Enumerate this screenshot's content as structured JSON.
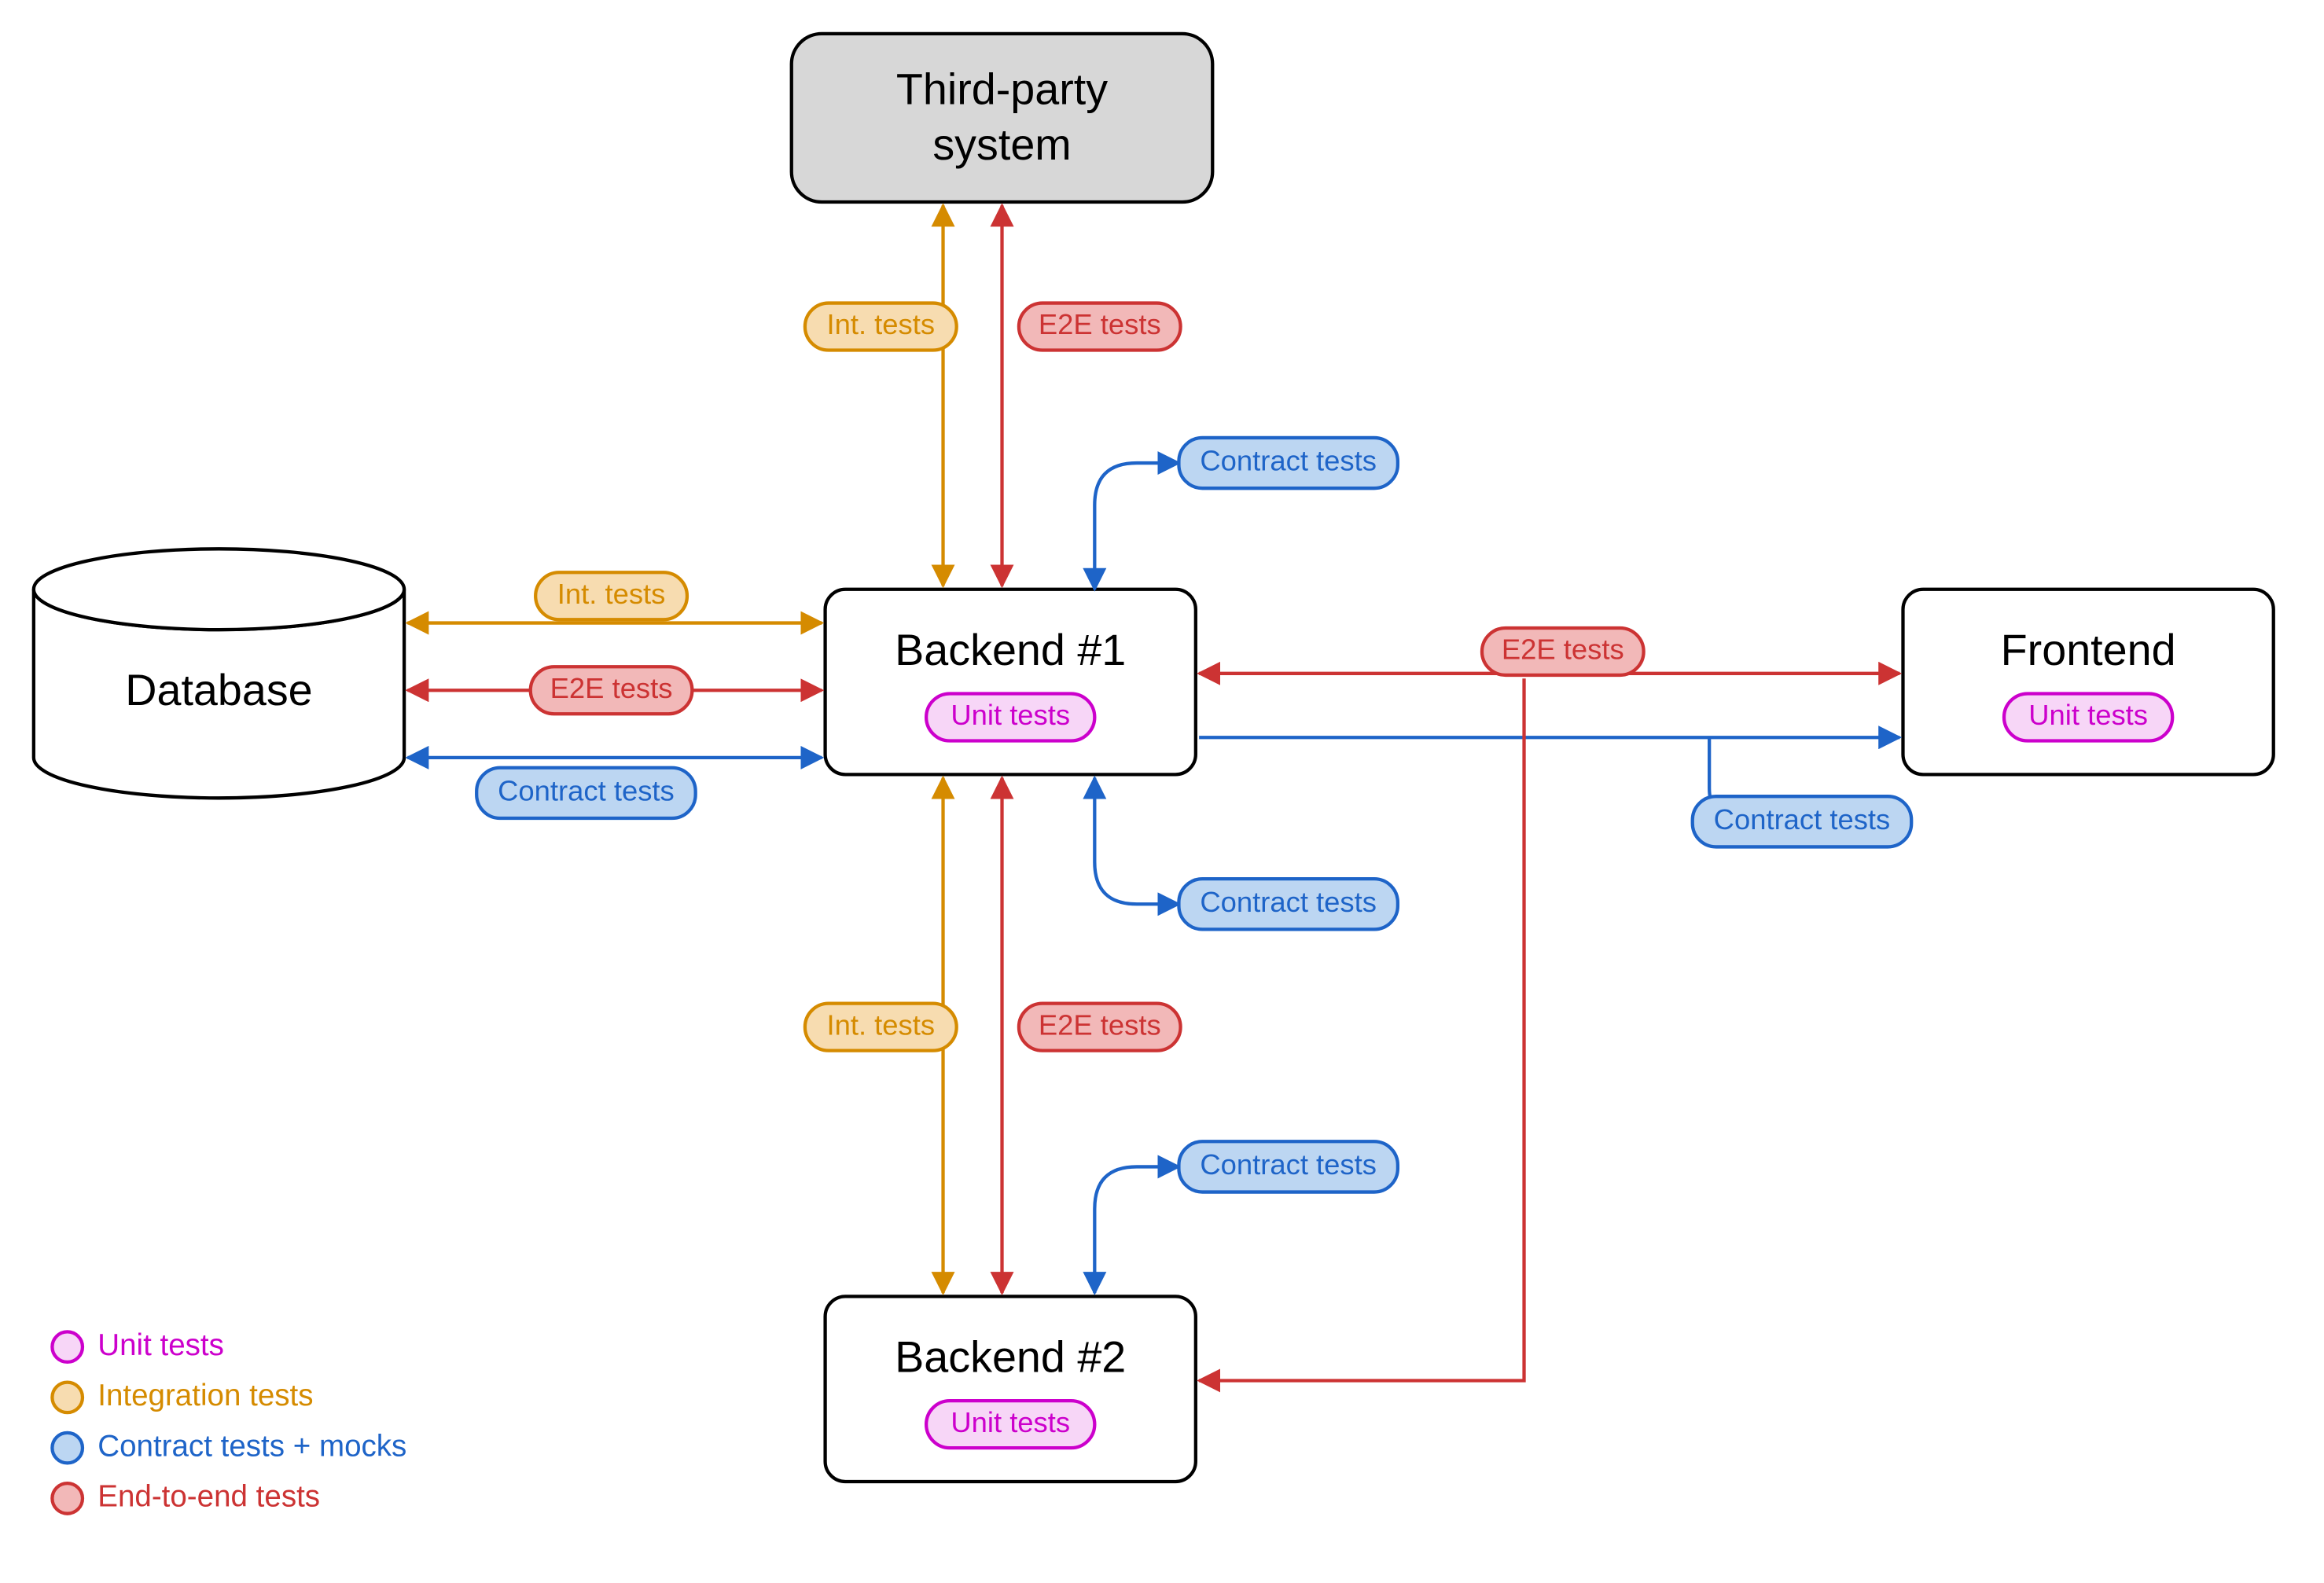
{
  "colors": {
    "unit": {
      "stroke": "#cc00cc",
      "fill": "#f7d6f7",
      "text": "#cc00cc"
    },
    "int": {
      "stroke": "#d58b00",
      "fill": "#f7dcb0",
      "text": "#d58b00"
    },
    "contract": {
      "stroke": "#1e64c8",
      "fill": "#bcd6f2",
      "text": "#1e64c8"
    },
    "e2e": {
      "stroke": "#cc3333",
      "fill": "#f2b8b8",
      "text": "#cc3333"
    },
    "black": "#000000"
  },
  "nodes": {
    "thirdparty": {
      "title1": "Third-party",
      "title2": "system"
    },
    "database": {
      "title": "Database"
    },
    "backend1": {
      "title": "Backend #1",
      "unit": "Unit tests"
    },
    "backend2": {
      "title": "Backend #2",
      "unit": "Unit tests"
    },
    "frontend": {
      "title": "Frontend",
      "unit": "Unit tests"
    }
  },
  "labels": {
    "int": "Int. tests",
    "e2e": "E2E tests",
    "contract": "Contract tests",
    "unit": "Unit tests"
  },
  "legend": {
    "unit": "Unit tests",
    "int": "Integration tests",
    "contract": "Contract tests + mocks",
    "e2e": "End-to-end tests"
  }
}
